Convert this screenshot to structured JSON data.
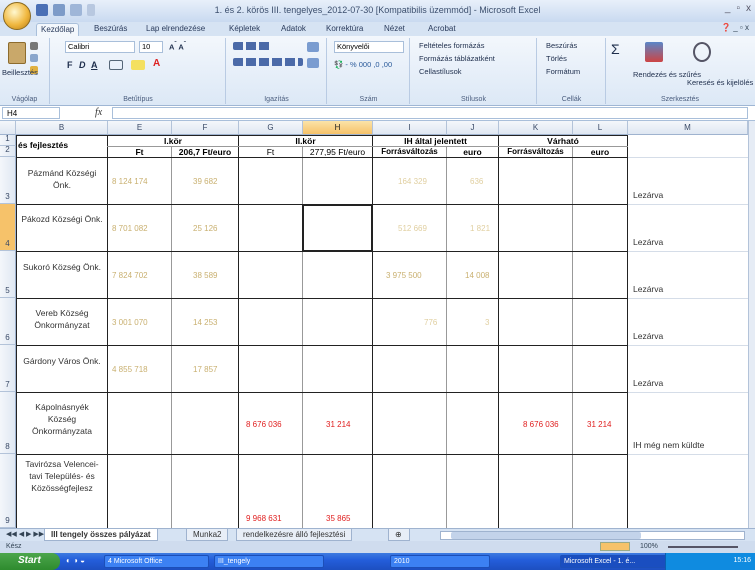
{
  "window": {
    "title": "1. és 2. körös III. tengelyes_2012-07-30 [Kompatibilis üzemmód] - Microsoft Excel",
    "controls": [
      "_",
      "▫",
      "x"
    ]
  },
  "ribbon": {
    "tabs": [
      "Kezdőlap",
      "Beszúrás",
      "Lap elrendezése",
      "Képletek",
      "Adatok",
      "Korrektúra",
      "Nézet",
      "Acrobat"
    ],
    "paste_label": "Beillesztés",
    "font_name": "Calibri",
    "font_size": "10",
    "number_format": "Könyvelői",
    "styles": [
      "Feltételes formázás",
      "Formázás táblázatként",
      "Cellastílusok"
    ],
    "cells": [
      "Beszúrás",
      "Törlés",
      "Formátum"
    ],
    "editing": [
      "Rendezés és szűrés",
      "Keresés és kijelölés"
    ],
    "groups": [
      "Vágólap",
      "Betűtípus",
      "Igazítás",
      "Szám",
      "Stílusok",
      "Cellák",
      "Szerkesztés"
    ]
  },
  "formula_bar": {
    "name_box": "H4",
    "fx": "fx",
    "content": ""
  },
  "columns": [
    "B",
    "E",
    "F",
    "G",
    "H",
    "I",
    "J",
    "K",
    "L",
    "M"
  ],
  "selected_column": "H",
  "header": {
    "b_title": "és fejlesztés",
    "kor1": "I.kör",
    "kor2": "II.kör",
    "ih": "IH által jelentett",
    "varhato": "Várható",
    "e_sub": "Ft",
    "f_sub": "206,7 Ft/euro",
    "g_sub": "Ft",
    "h_sub": "277,95 Ft/euro",
    "i_sub": "Forrásváltozás",
    "j_sub": "euro",
    "k_sub": "Forrásváltozás",
    "l_sub": "euro"
  },
  "rows": [
    {
      "num": "3",
      "name": "Pázmánd Községi Önk.",
      "e": "8 124 174",
      "f": "39 682",
      "g": "",
      "h": "",
      "i": "164 329",
      "j": "636",
      "k": "",
      "l": "",
      "m": "Lezárva"
    },
    {
      "num": "4",
      "name": "Pákozd Községi Önk.",
      "e": "8 701 082",
      "f": "25 126",
      "g": "",
      "h": "",
      "i": "512 669",
      "j": "1 821",
      "k": "",
      "l": "",
      "m": "Lezárva"
    },
    {
      "num": "5",
      "name": "Sukoró Község Önk.",
      "e": "7 824 702",
      "f": "38 589",
      "g": "",
      "h": "",
      "i": "3 975 500",
      "j": "14 008",
      "k": "",
      "l": "",
      "m": "Lezárva"
    },
    {
      "num": "6",
      "name": "Vereb Község Önkormányzat",
      "e": "3 001 070",
      "f": "14 253",
      "g": "",
      "h": "",
      "i": "776",
      "j": "3",
      "k": "",
      "l": "",
      "m": "Lezárva"
    },
    {
      "num": "7",
      "name": "Gárdony Város Önk.",
      "e": "4 855 718",
      "f": "17 857",
      "g": "",
      "h": "",
      "i": "",
      "j": "",
      "k": "",
      "l": "",
      "m": "Lezárva"
    },
    {
      "num": "8",
      "name": "Kápolnásnyék Község Önkormányzata",
      "e": "",
      "f": "",
      "g": "8 676 036",
      "h": "31 214",
      "i": "",
      "j": "",
      "k": "8 676 036",
      "l": "31 214",
      "m": "IH még nem küldte"
    },
    {
      "num": "9",
      "name": "Tavirózsa Velencei-tavi Település- és Közösségfejlesz",
      "e": "",
      "f": "",
      "g": "9 968 631",
      "h": "35 865",
      "i": "",
      "j": "",
      "k": "",
      "l": "",
      "m": ""
    }
  ],
  "sheet_tabs": [
    "III tengely összes pályázat",
    "Munka2",
    "rendelkezésre álló fejlesztési"
  ],
  "status": {
    "left": "Kész",
    "zoom": "100%"
  },
  "taskbar": {
    "start": "Start",
    "buttons": [
      "4 Microsoft Office",
      "III_tengely",
      "2010",
      "Microsoft Excel - 1. é..."
    ],
    "clock": "15:16"
  }
}
